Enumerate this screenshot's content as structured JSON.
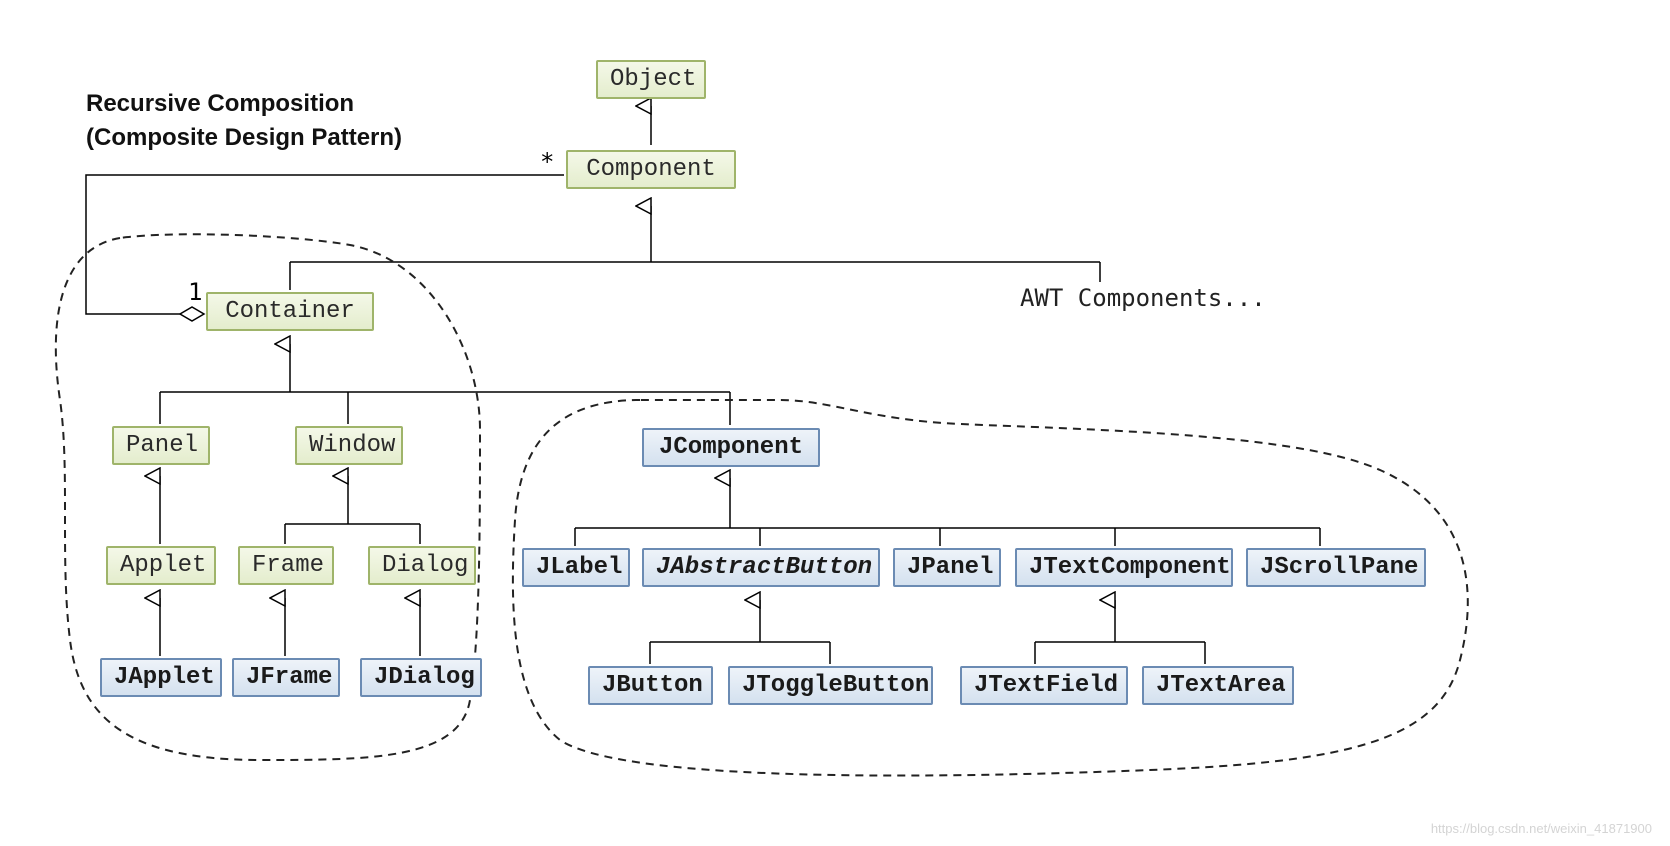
{
  "title": {
    "line1": "Recursive Composition",
    "line2": "(Composite Design Pattern)"
  },
  "multiplicity": {
    "star": "*",
    "one": "1"
  },
  "nodes": {
    "object": "Object",
    "component": "Component",
    "container": "Container",
    "panel": "Panel",
    "window": "Window",
    "applet": "Applet",
    "frame": "Frame",
    "dialog": "Dialog",
    "japplet": "JApplet",
    "jframe": "JFrame",
    "jdialog": "JDialog",
    "jcomponent": "JComponent",
    "jlabel": "JLabel",
    "jabstractbutton": "JAbstractButton",
    "jpanel": "JPanel",
    "jtextcomponent": "JTextComponent",
    "jscrollpane": "JScrollPane",
    "jbutton": "JButton",
    "jtogglebutton": "JToggleButton",
    "jtextfield": "JTextField",
    "jtextarea": "JTextArea"
  },
  "awtLabel": "AWT Components...",
  "watermark": "https://blog.csdn.net/weixin_41871900"
}
